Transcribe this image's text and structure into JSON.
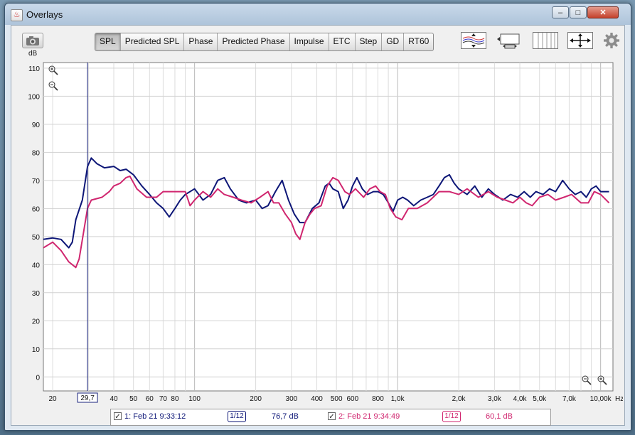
{
  "window": {
    "title": "Overlays",
    "minimize_label": "‒",
    "maximize_label": "□",
    "close_label": "✕"
  },
  "tabs": [
    {
      "label": "SPL",
      "active": true
    },
    {
      "label": "Predicted SPL",
      "active": false
    },
    {
      "label": "Phase",
      "active": false
    },
    {
      "label": "Predicted Phase",
      "active": false
    },
    {
      "label": "Impulse",
      "active": false
    },
    {
      "label": "ETC",
      "active": false
    },
    {
      "label": "Step",
      "active": false
    },
    {
      "label": "GD",
      "active": false
    },
    {
      "label": "RT60",
      "active": false
    }
  ],
  "toolbar_icons": [
    "camera-icon",
    "vertical-scale-icon",
    "horizontal-scale-icon",
    "grid-columns-icon",
    "fit-arrows-icon",
    "gear-icon"
  ],
  "cursor": {
    "x_label": "29,7"
  },
  "legend": {
    "m1": {
      "label": "1: Feb 21 9:33:12",
      "smoothing": "1/12",
      "value": "76,7 dB",
      "color": "#0d1677",
      "checked": true
    },
    "m2": {
      "label": "2: Feb 21 9:34:49",
      "smoothing": "1/12",
      "value": "60,1 dB",
      "color": "#d0266f",
      "checked": true
    }
  },
  "chart_data": {
    "type": "line",
    "ylabel": "dB",
    "xlabel": "Hz",
    "x_scale": "log",
    "xlim": [
      18,
      11500
    ],
    "ylim": [
      -5,
      112
    ],
    "y_ticks": [
      0,
      10,
      20,
      30,
      40,
      50,
      60,
      70,
      80,
      90,
      100,
      110
    ],
    "x_tick_labels": [
      {
        "v": 20,
        "t": "20"
      },
      {
        "v": 40,
        "t": "40"
      },
      {
        "v": 50,
        "t": "50"
      },
      {
        "v": 60,
        "t": "60"
      },
      {
        "v": 70,
        "t": "70"
      },
      {
        "v": 80,
        "t": "80"
      },
      {
        "v": 100,
        "t": "100"
      },
      {
        "v": 200,
        "t": "200"
      },
      {
        "v": 300,
        "t": "300"
      },
      {
        "v": 400,
        "t": "400"
      },
      {
        "v": 500,
        "t": "500"
      },
      {
        "v": 600,
        "t": "600"
      },
      {
        "v": 800,
        "t": "800"
      },
      {
        "v": 1000,
        "t": "1,0k"
      },
      {
        "v": 2000,
        "t": "2,0k"
      },
      {
        "v": 3000,
        "t": "3,0k"
      },
      {
        "v": 4000,
        "t": "4,0k"
      },
      {
        "v": 5000,
        "t": "5,0k"
      },
      {
        "v": 7000,
        "t": "7,0k"
      },
      {
        "v": 10000,
        "t": "10,00k"
      }
    ],
    "cursor_x": 29.7,
    "grid": true,
    "series": [
      {
        "name": "1: Feb 21 9:33:12",
        "color": "#0d1677",
        "points": [
          [
            18,
            49
          ],
          [
            20,
            49.5
          ],
          [
            22,
            49
          ],
          [
            24,
            46
          ],
          [
            25,
            48
          ],
          [
            26,
            56
          ],
          [
            28,
            63
          ],
          [
            29.7,
            75
          ],
          [
            31,
            78
          ],
          [
            33,
            76
          ],
          [
            36,
            74.5
          ],
          [
            40,
            75
          ],
          [
            43,
            73.5
          ],
          [
            46,
            74
          ],
          [
            50,
            72
          ],
          [
            55,
            68
          ],
          [
            60,
            65
          ],
          [
            65,
            62
          ],
          [
            70,
            60
          ],
          [
            75,
            57
          ],
          [
            80,
            60
          ],
          [
            85,
            63
          ],
          [
            90,
            65
          ],
          [
            100,
            67
          ],
          [
            110,
            63
          ],
          [
            120,
            65
          ],
          [
            130,
            70
          ],
          [
            140,
            71
          ],
          [
            150,
            67
          ],
          [
            165,
            63
          ],
          [
            180,
            62
          ],
          [
            200,
            63
          ],
          [
            215,
            60
          ],
          [
            230,
            61
          ],
          [
            250,
            66
          ],
          [
            270,
            70
          ],
          [
            290,
            63
          ],
          [
            310,
            58
          ],
          [
            330,
            55
          ],
          [
            350,
            55
          ],
          [
            380,
            60
          ],
          [
            410,
            62
          ],
          [
            440,
            68
          ],
          [
            460,
            69
          ],
          [
            480,
            67
          ],
          [
            510,
            66
          ],
          [
            540,
            60
          ],
          [
            570,
            63
          ],
          [
            600,
            68
          ],
          [
            630,
            71
          ],
          [
            670,
            67
          ],
          [
            710,
            65
          ],
          [
            760,
            66
          ],
          [
            800,
            66
          ],
          [
            850,
            65
          ],
          [
            900,
            62
          ],
          [
            950,
            59
          ],
          [
            1000,
            63
          ],
          [
            1060,
            64
          ],
          [
            1120,
            63
          ],
          [
            1200,
            61
          ],
          [
            1300,
            63
          ],
          [
            1400,
            64
          ],
          [
            1500,
            65
          ],
          [
            1600,
            68
          ],
          [
            1700,
            71
          ],
          [
            1800,
            72
          ],
          [
            1900,
            69
          ],
          [
            2000,
            67
          ],
          [
            2200,
            65
          ],
          [
            2400,
            68
          ],
          [
            2600,
            64
          ],
          [
            2800,
            67
          ],
          [
            3000,
            65
          ],
          [
            3300,
            63
          ],
          [
            3600,
            65
          ],
          [
            3900,
            64
          ],
          [
            4200,
            66
          ],
          [
            4500,
            64
          ],
          [
            4800,
            66
          ],
          [
            5200,
            65
          ],
          [
            5600,
            67
          ],
          [
            6000,
            66
          ],
          [
            6500,
            70
          ],
          [
            7000,
            67
          ],
          [
            7500,
            65
          ],
          [
            8000,
            66
          ],
          [
            8500,
            64
          ],
          [
            9000,
            67
          ],
          [
            9500,
            68
          ],
          [
            10000,
            66
          ],
          [
            11000,
            66
          ]
        ]
      },
      {
        "name": "2: Feb 21 9:34:49",
        "color": "#d0266f",
        "points": [
          [
            18,
            46
          ],
          [
            20,
            48
          ],
          [
            22,
            45
          ],
          [
            24,
            41
          ],
          [
            26,
            39
          ],
          [
            27,
            42
          ],
          [
            29.7,
            60.1
          ],
          [
            31,
            63
          ],
          [
            35,
            64
          ],
          [
            38,
            66
          ],
          [
            40,
            68
          ],
          [
            43,
            69
          ],
          [
            46,
            71
          ],
          [
            48,
            71.5
          ],
          [
            52,
            67
          ],
          [
            58,
            64
          ],
          [
            65,
            64
          ],
          [
            70,
            66
          ],
          [
            80,
            66
          ],
          [
            90,
            66
          ],
          [
            95,
            61
          ],
          [
            100,
            63
          ],
          [
            110,
            66
          ],
          [
            120,
            64
          ],
          [
            130,
            67
          ],
          [
            140,
            65
          ],
          [
            155,
            64
          ],
          [
            170,
            63
          ],
          [
            190,
            62
          ],
          [
            210,
            64
          ],
          [
            230,
            66
          ],
          [
            245,
            62
          ],
          [
            260,
            62
          ],
          [
            280,
            58
          ],
          [
            300,
            55
          ],
          [
            315,
            51
          ],
          [
            330,
            49
          ],
          [
            350,
            55
          ],
          [
            370,
            58
          ],
          [
            390,
            60
          ],
          [
            420,
            61
          ],
          [
            450,
            68
          ],
          [
            480,
            71
          ],
          [
            510,
            70
          ],
          [
            550,
            66
          ],
          [
            580,
            65
          ],
          [
            620,
            67
          ],
          [
            680,
            64
          ],
          [
            730,
            67
          ],
          [
            780,
            68
          ],
          [
            820,
            66
          ],
          [
            870,
            65
          ],
          [
            920,
            60
          ],
          [
            980,
            57
          ],
          [
            1050,
            56
          ],
          [
            1130,
            60
          ],
          [
            1250,
            60
          ],
          [
            1400,
            62
          ],
          [
            1600,
            66
          ],
          [
            1800,
            66
          ],
          [
            2000,
            65
          ],
          [
            2200,
            67
          ],
          [
            2500,
            64
          ],
          [
            2800,
            66
          ],
          [
            3100,
            64
          ],
          [
            3400,
            63
          ],
          [
            3700,
            62
          ],
          [
            4000,
            64
          ],
          [
            4300,
            62
          ],
          [
            4600,
            61
          ],
          [
            5000,
            64
          ],
          [
            5500,
            65
          ],
          [
            6000,
            63
          ],
          [
            6600,
            64
          ],
          [
            7200,
            65
          ],
          [
            8000,
            62
          ],
          [
            8700,
            62
          ],
          [
            9300,
            66
          ],
          [
            10000,
            65
          ],
          [
            11000,
            62
          ]
        ]
      }
    ]
  }
}
